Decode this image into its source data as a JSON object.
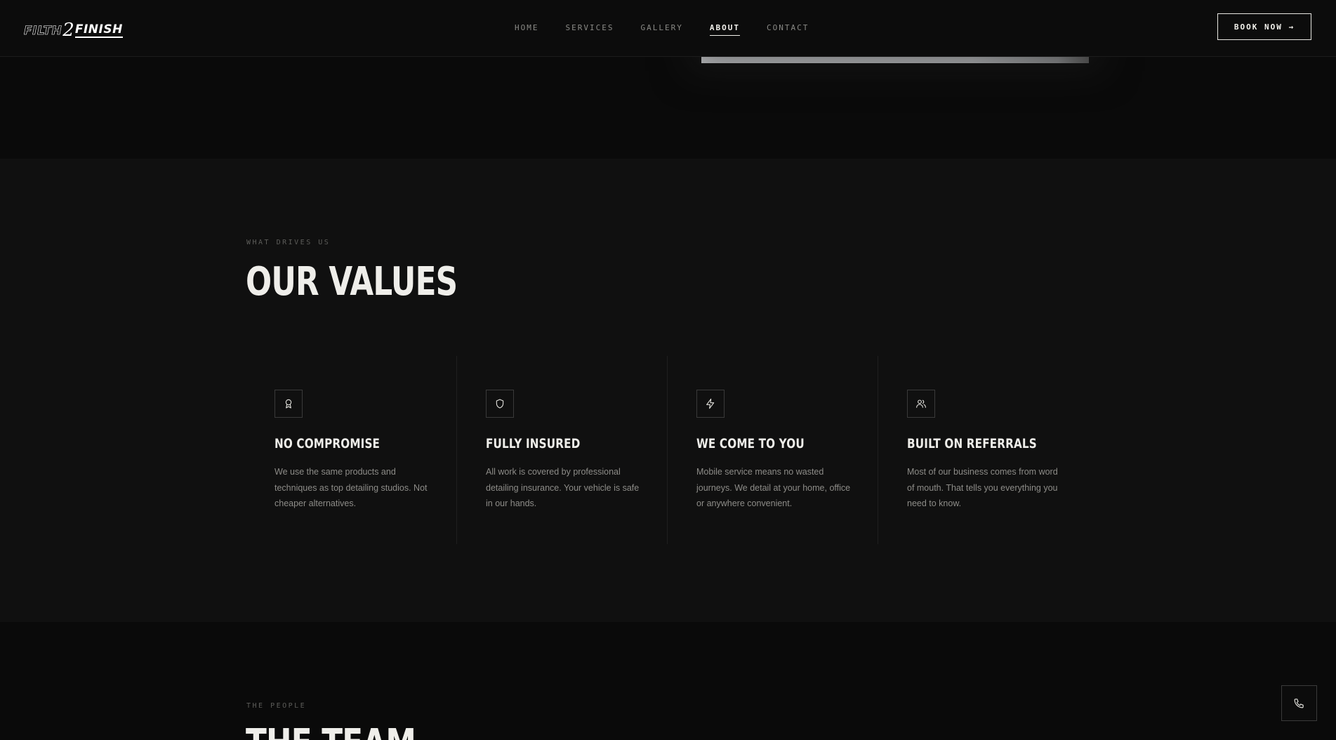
{
  "header": {
    "logo_part1": "FILTH",
    "logo_part2": "2",
    "logo_part3": "FINISH",
    "nav": [
      {
        "label": "HOME"
      },
      {
        "label": "SERVICES"
      },
      {
        "label": "GALLERY"
      },
      {
        "label": "ABOUT",
        "active": true
      },
      {
        "label": "CONTACT"
      }
    ],
    "book_label": "BOOK NOW →"
  },
  "values_section": {
    "eyebrow": "WHAT DRIVES US",
    "title": "OUR VALUES",
    "cards": [
      {
        "icon": "award-icon",
        "title": "NO COMPROMISE",
        "text": "We use the same products and techniques as top detailing studios. Not cheaper alternatives."
      },
      {
        "icon": "shield-icon",
        "title": "FULLY INSURED",
        "text": "All work is covered by professional detailing insurance. Your vehicle is safe in our hands."
      },
      {
        "icon": "lightning-icon",
        "title": "WE COME TO YOU",
        "text": "Mobile service means no wasted journeys. We detail at your home, office or anywhere convenient."
      },
      {
        "icon": "users-icon",
        "title": "BUILT ON REFERRALS",
        "text": "Most of our business comes from word of mouth. That tells you everything you need to know."
      }
    ]
  },
  "team_section": {
    "eyebrow": "THE PEOPLE",
    "title": "THE TEAM"
  },
  "floating": {
    "phone_icon": "phone-icon"
  },
  "colors": {
    "background": "#0a0a0a",
    "section_background": "#101010",
    "text_primary": "#efeeea",
    "text_muted": "#8d8c88"
  }
}
